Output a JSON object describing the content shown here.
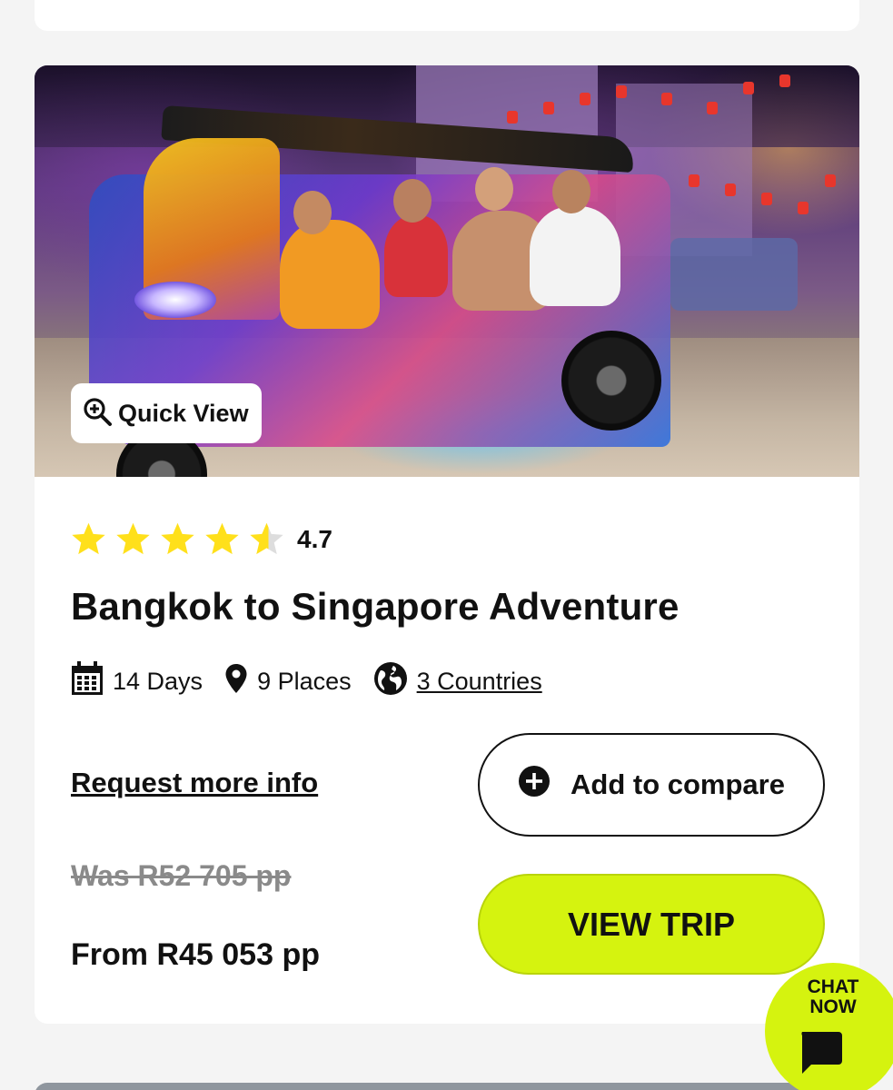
{
  "card": {
    "quick_view_label": "Quick View",
    "rating": {
      "value": "4.7",
      "stars": 4.7
    },
    "title": "Bangkok to Singapore Adventure",
    "meta": {
      "days": "14 Days",
      "places": "9 Places",
      "countries": "3 Countries"
    },
    "request_info_label": "Request more info",
    "compare_label": "Add to compare",
    "was_price": "Was R52 705 pp",
    "from_price": "From R45 053 pp",
    "view_trip_label": "VIEW TRIP"
  },
  "chat": {
    "label": "CHAT NOW"
  },
  "colors": {
    "accent": "#d5f30f",
    "star": "#ffe01b",
    "text": "#111111",
    "strike_price": "#8a8a8a",
    "background": "#f4f4f4"
  },
  "icons": {
    "quick_view": "zoom-plus-icon",
    "days": "calendar-icon",
    "places": "location-pin-icon",
    "countries": "globe-icon",
    "compare": "plus-circle-icon",
    "chat": "chat-bubble-icon"
  }
}
